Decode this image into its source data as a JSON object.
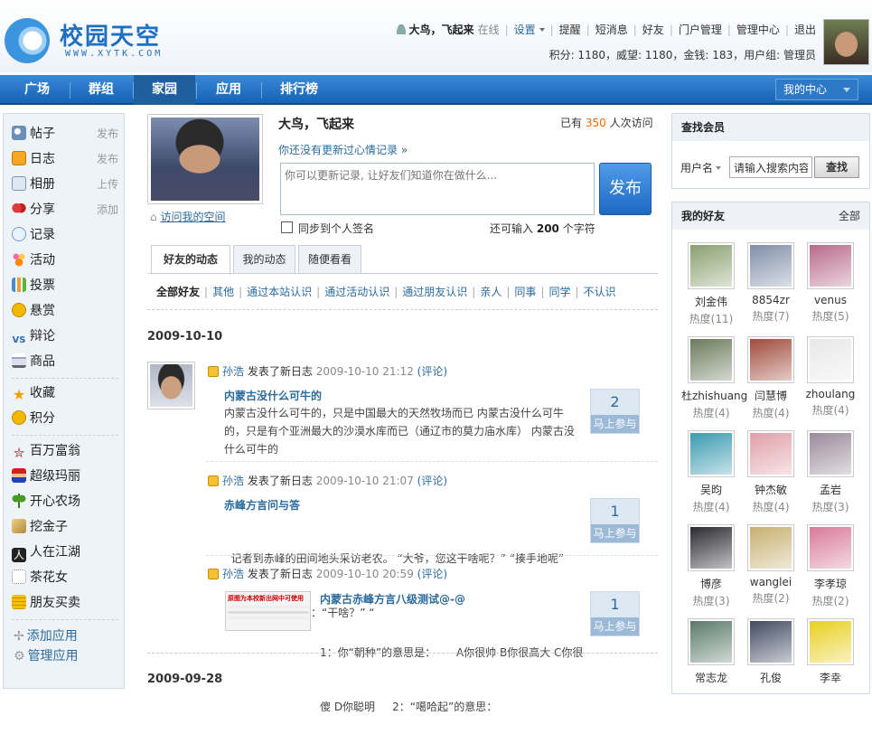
{
  "header": {
    "logo_text": "校园天空",
    "logo_url": "WWW.XYTK.COM",
    "user_name": "大鸟，飞起来",
    "online_status": "在线",
    "links": [
      "设置",
      "提醒",
      "短消息",
      "好友",
      "门户管理",
      "管理中心",
      "退出"
    ],
    "credit_line": "积分: 1180，威望: 1180，金钱: 183，用户组: 管理员"
  },
  "nav": {
    "items": [
      "广场",
      "群组",
      "家园",
      "应用",
      "排行榜"
    ],
    "active": "家园",
    "my_center": "我的中心"
  },
  "sidebar": {
    "apps": [
      {
        "label": "帖子",
        "action": "发布",
        "icon": "post-icon"
      },
      {
        "label": "日志",
        "action": "发布",
        "icon": "blog-icon"
      },
      {
        "label": "相册",
        "action": "上传",
        "icon": "album-icon"
      },
      {
        "label": "分享",
        "action": "添加",
        "icon": "share-icon"
      },
      {
        "label": "记录",
        "action": "",
        "icon": "record-icon"
      },
      {
        "label": "活动",
        "action": "",
        "icon": "activity-icon"
      },
      {
        "label": "投票",
        "action": "",
        "icon": "poll-icon"
      },
      {
        "label": "悬赏",
        "action": "",
        "icon": "reward-icon"
      },
      {
        "label": "辩论",
        "action": "",
        "icon": "debate-icon"
      },
      {
        "label": "商品",
        "action": "",
        "icon": "goods-icon"
      }
    ],
    "personal": [
      {
        "label": "收藏",
        "icon": "favorite-icon"
      },
      {
        "label": "积分",
        "icon": "points-icon"
      }
    ],
    "games": [
      {
        "label": "百万富翁",
        "icon": "millionaire-icon"
      },
      {
        "label": "超级玛丽",
        "icon": "mario-icon"
      },
      {
        "label": "开心农场",
        "icon": "farm-icon"
      },
      {
        "label": "挖金子",
        "icon": "gold-icon"
      },
      {
        "label": "人在江湖",
        "icon": "jianghu-icon"
      },
      {
        "label": "茶花女",
        "icon": "camellia-icon"
      },
      {
        "label": "朋友买卖",
        "icon": "trade-icon"
      }
    ],
    "add_app": "添加应用",
    "manage_app": "管理应用"
  },
  "profile": {
    "name": "大鸟，飞起来",
    "visit_prefix": "已有",
    "visit_count": "350",
    "visit_suffix": "人次访问",
    "mood_link": "你还没有更新过心情记录 »",
    "status_placeholder": "你可以更新记录, 让好友们知道你在做什么...",
    "publish": "发布",
    "visit_space": "访问我的空间",
    "sync_label": "同步到个人签名",
    "char_prefix": "还可输入",
    "char_count": "200",
    "char_suffix": "个字符"
  },
  "tabs": [
    "好友的动态",
    "我的动态",
    "随便看看"
  ],
  "filters": [
    "全部好友",
    "其他",
    "通过本站认识",
    "通过活动认识",
    "通过朋友认识",
    "亲人",
    "同事",
    "同学",
    "不认识"
  ],
  "feed": {
    "date1": "2009-10-10",
    "date2": "2009-09-28",
    "items": [
      {
        "user": "孙浩",
        "action": "发表了新日志",
        "time": "2009-10-10 21:12",
        "comment": "(评论)",
        "title": "内蒙古没什么可牛的",
        "body_lines": [
          "内蒙古没什么可牛的，只是中国最大的天然牧场而已 内蒙古没什么可牛",
          "的，只是有个亚洲最大的沙漠水库而已（通辽市的莫力庙水库） 内蒙古没",
          "什么可牛的"
        ],
        "count": "2",
        "join": "马上参与"
      },
      {
        "user": "孙浩",
        "action": "发表了新日志",
        "time": "2009-10-10 21:07",
        "comment": "(评论)",
        "title": "赤峰方言问与答",
        "body_lines": [
          "  记者到赤峰的田间地头采访老农。 “大爷，您这干啥呢？” “揍手地呢”",
          "（记者不懂）追问：“干啥？” “"
        ],
        "count": "1",
        "join": "马上参与"
      },
      {
        "user": "孙浩",
        "action": "发表了新日志",
        "time": "2009-10-10 20:59",
        "comment": "(评论)",
        "title": "内蒙古赤峰方言八级测试@-@",
        "body_lines": [
          "1：你“朝种”的意思是：      A你很帅 B你很高大 C你很",
          "傻 D你聪明     2：“噶哈起”的意思："
        ],
        "thumb_text": "原图为本校新出网中可使用",
        "count": "1",
        "join": "马上参与"
      }
    ]
  },
  "search": {
    "title": "查找会员",
    "type_label": "用户名",
    "placeholder": "请输入搜索内容",
    "button": "查找"
  },
  "friends": {
    "title": "我的好友",
    "all": "全部",
    "list": [
      {
        "name": "刘金伟",
        "heat": "热度(11)",
        "color": "#8aa070"
      },
      {
        "name": "8854zr",
        "heat": "热度(7)",
        "color": "#7f8fa8"
      },
      {
        "name": "venus",
        "heat": "热度(5)",
        "color": "#b86a8a"
      },
      {
        "name": "杜zhishuang",
        "heat": "热度(4)",
        "color": "#6a7a5a"
      },
      {
        "name": "闫慧博",
        "heat": "热度(4)",
        "color": "#a04a3a"
      },
      {
        "name": "zhoulang",
        "heat": "热度(4)",
        "color": "#e8e8e8"
      },
      {
        "name": "吴昀",
        "heat": "热度(4)",
        "color": "#3a9ab0"
      },
      {
        "name": "钟杰敏",
        "heat": "热度(4)",
        "color": "#e0a0a8"
      },
      {
        "name": "孟岩",
        "heat": "热度(3)",
        "color": "#9a8a9a"
      },
      {
        "name": "博彦",
        "heat": "热度(3)",
        "color": "#2a2a30"
      },
      {
        "name": "wanglei",
        "heat": "热度(2)",
        "color": "#c8b070"
      },
      {
        "name": "李孝琼",
        "heat": "热度(2)",
        "color": "#d87a9a"
      },
      {
        "name": "常志龙",
        "heat": "",
        "color": "#5a7a6a"
      },
      {
        "name": "孔俊",
        "heat": "",
        "color": "#404a60"
      },
      {
        "name": "李幸",
        "heat": "",
        "color": "#e8d020"
      }
    ]
  }
}
